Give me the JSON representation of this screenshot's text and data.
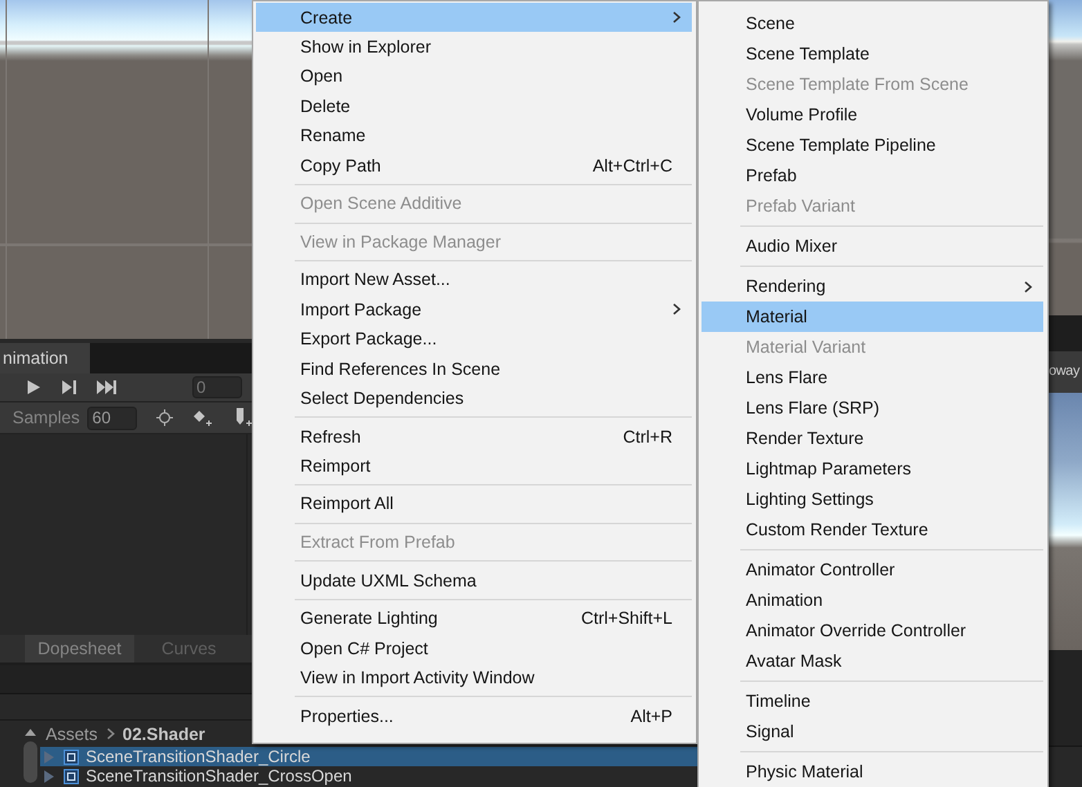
{
  "animation_panel": {
    "tab": "nimation",
    "frame_field": "0",
    "samples_label": "Samples",
    "samples_value": "60",
    "view_tabs": [
      {
        "label": "Dopesheet",
        "selected": true
      },
      {
        "label": "Curves",
        "selected": false
      }
    ]
  },
  "project": {
    "breadcrumb": [
      "Assets",
      "02.Shader"
    ],
    "rows": [
      {
        "name": "SceneTransitionShader_Circle",
        "selected": true
      },
      {
        "name": "SceneTransitionShader_CrossOpen",
        "selected": false
      }
    ]
  },
  "right_strip": {
    "label": "oway"
  },
  "menus": [
    {
      "items": [
        {
          "kind": "item",
          "label": "Create",
          "submenu": true,
          "disabled": false,
          "selected": true
        },
        {
          "kind": "item",
          "label": "Show in Explorer",
          "submenu": false,
          "disabled": false,
          "selected": false
        },
        {
          "kind": "item",
          "label": "Open",
          "submenu": false,
          "disabled": false,
          "selected": false
        },
        {
          "kind": "item",
          "label": "Delete",
          "submenu": false,
          "disabled": false,
          "selected": false
        },
        {
          "kind": "item",
          "label": "Rename",
          "submenu": false,
          "disabled": false,
          "selected": false
        },
        {
          "kind": "item",
          "label": "Copy Path",
          "shortcut": "Alt+Ctrl+C",
          "submenu": false,
          "disabled": false,
          "selected": false
        },
        {
          "kind": "separator"
        },
        {
          "kind": "item",
          "label": "Open Scene Additive",
          "submenu": false,
          "disabled": true,
          "selected": false
        },
        {
          "kind": "separator"
        },
        {
          "kind": "item",
          "label": "View in Package Manager",
          "submenu": false,
          "disabled": true,
          "selected": false
        },
        {
          "kind": "separator"
        },
        {
          "kind": "item",
          "label": "Import New Asset...",
          "submenu": false,
          "disabled": false,
          "selected": false
        },
        {
          "kind": "item",
          "label": "Import Package",
          "submenu": true,
          "disabled": false,
          "selected": false
        },
        {
          "kind": "item",
          "label": "Export Package...",
          "submenu": false,
          "disabled": false,
          "selected": false
        },
        {
          "kind": "item",
          "label": "Find References In Scene",
          "submenu": false,
          "disabled": false,
          "selected": false
        },
        {
          "kind": "item",
          "label": "Select Dependencies",
          "submenu": false,
          "disabled": false,
          "selected": false
        },
        {
          "kind": "separator"
        },
        {
          "kind": "item",
          "label": "Refresh",
          "shortcut": "Ctrl+R",
          "submenu": false,
          "disabled": false,
          "selected": false
        },
        {
          "kind": "item",
          "label": "Reimport",
          "submenu": false,
          "disabled": false,
          "selected": false
        },
        {
          "kind": "separator"
        },
        {
          "kind": "item",
          "label": "Reimport All",
          "submenu": false,
          "disabled": false,
          "selected": false
        },
        {
          "kind": "separator"
        },
        {
          "kind": "item",
          "label": "Extract From Prefab",
          "submenu": false,
          "disabled": true,
          "selected": false
        },
        {
          "kind": "separator"
        },
        {
          "kind": "item",
          "label": "Update UXML Schema",
          "submenu": false,
          "disabled": false,
          "selected": false
        },
        {
          "kind": "separator"
        },
        {
          "kind": "item",
          "label": "Generate Lighting",
          "shortcut": "Ctrl+Shift+L",
          "submenu": false,
          "disabled": false,
          "selected": false
        },
        {
          "kind": "item",
          "label": "Open C# Project",
          "submenu": false,
          "disabled": false,
          "selected": false
        },
        {
          "kind": "item",
          "label": "View in Import Activity Window",
          "submenu": false,
          "disabled": false,
          "selected": false
        },
        {
          "kind": "separator"
        },
        {
          "kind": "item",
          "label": "Properties...",
          "shortcut": "Alt+P",
          "submenu": false,
          "disabled": false,
          "selected": false
        }
      ]
    },
    {
      "items": [
        {
          "kind": "item",
          "label": "Scene",
          "submenu": false,
          "disabled": false,
          "selected": false
        },
        {
          "kind": "item",
          "label": "Scene Template",
          "submenu": false,
          "disabled": false,
          "selected": false
        },
        {
          "kind": "item",
          "label": "Scene Template From Scene",
          "submenu": false,
          "disabled": true,
          "selected": false
        },
        {
          "kind": "item",
          "label": "Volume Profile",
          "submenu": false,
          "disabled": false,
          "selected": false
        },
        {
          "kind": "item",
          "label": "Scene Template Pipeline",
          "submenu": false,
          "disabled": false,
          "selected": false
        },
        {
          "kind": "item",
          "label": "Prefab",
          "submenu": false,
          "disabled": false,
          "selected": false
        },
        {
          "kind": "item",
          "label": "Prefab Variant",
          "submenu": false,
          "disabled": true,
          "selected": false
        },
        {
          "kind": "separator"
        },
        {
          "kind": "item",
          "label": "Audio Mixer",
          "submenu": false,
          "disabled": false,
          "selected": false
        },
        {
          "kind": "separator"
        },
        {
          "kind": "item",
          "label": "Rendering",
          "submenu": true,
          "disabled": false,
          "selected": false
        },
        {
          "kind": "item",
          "label": "Material",
          "submenu": false,
          "disabled": false,
          "selected": true
        },
        {
          "kind": "item",
          "label": "Material Variant",
          "submenu": false,
          "disabled": true,
          "selected": false
        },
        {
          "kind": "item",
          "label": "Lens Flare",
          "submenu": false,
          "disabled": false,
          "selected": false
        },
        {
          "kind": "item",
          "label": "Lens Flare (SRP)",
          "submenu": false,
          "disabled": false,
          "selected": false
        },
        {
          "kind": "item",
          "label": "Render Texture",
          "submenu": false,
          "disabled": false,
          "selected": false
        },
        {
          "kind": "item",
          "label": "Lightmap Parameters",
          "submenu": false,
          "disabled": false,
          "selected": false
        },
        {
          "kind": "item",
          "label": "Lighting Settings",
          "submenu": false,
          "disabled": false,
          "selected": false
        },
        {
          "kind": "item",
          "label": "Custom Render Texture",
          "submenu": false,
          "disabled": false,
          "selected": false
        },
        {
          "kind": "separator"
        },
        {
          "kind": "item",
          "label": "Animator Controller",
          "submenu": false,
          "disabled": false,
          "selected": false
        },
        {
          "kind": "item",
          "label": "Animation",
          "submenu": false,
          "disabled": false,
          "selected": false
        },
        {
          "kind": "item",
          "label": "Animator Override Controller",
          "submenu": false,
          "disabled": false,
          "selected": false
        },
        {
          "kind": "item",
          "label": "Avatar Mask",
          "submenu": false,
          "disabled": false,
          "selected": false
        },
        {
          "kind": "separator"
        },
        {
          "kind": "item",
          "label": "Timeline",
          "submenu": false,
          "disabled": false,
          "selected": false
        },
        {
          "kind": "item",
          "label": "Signal",
          "submenu": false,
          "disabled": false,
          "selected": false
        },
        {
          "kind": "separator"
        },
        {
          "kind": "item",
          "label": "Physic Material",
          "submenu": false,
          "disabled": false,
          "selected": false
        }
      ]
    }
  ]
}
